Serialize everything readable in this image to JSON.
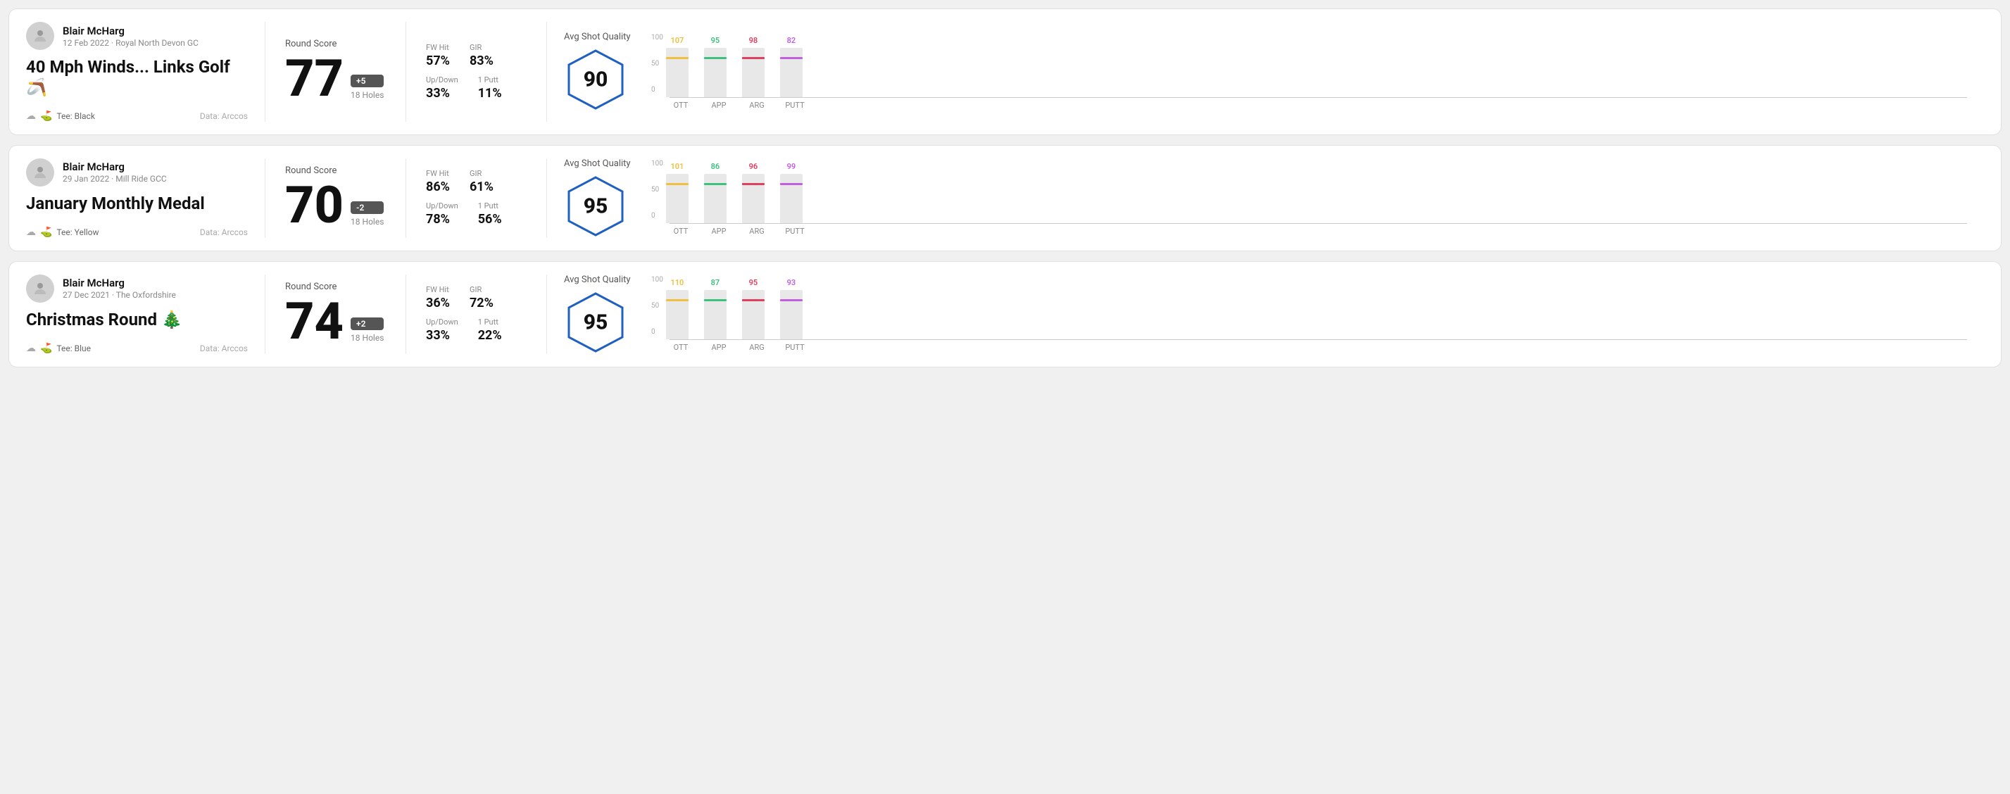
{
  "rounds": [
    {
      "id": "round-1",
      "user": {
        "name": "Blair McHarg",
        "meta": "12 Feb 2022 · Royal North Devon GC"
      },
      "title": "40 Mph Winds... Links Golf 🪃",
      "tee": "Black",
      "data_source": "Data: Arccos",
      "score": {
        "label": "Round Score",
        "number": "77",
        "modifier": "+5",
        "modifier_type": "over",
        "holes": "18 Holes"
      },
      "stats": {
        "fw_hit_label": "FW Hit",
        "fw_hit_value": "57%",
        "gir_label": "GIR",
        "gir_value": "83%",
        "updown_label": "Up/Down",
        "updown_value": "33%",
        "oneputt_label": "1 Putt",
        "oneputt_value": "11%"
      },
      "quality": {
        "label": "Avg Shot Quality",
        "score": "90"
      },
      "chart": {
        "bars": [
          {
            "label": "OTT",
            "value": 107,
            "color": "#f0c040",
            "max": 130
          },
          {
            "label": "APP",
            "value": 95,
            "color": "#40c080",
            "max": 130
          },
          {
            "label": "ARG",
            "value": 98,
            "color": "#e04060",
            "max": 130
          },
          {
            "label": "PUTT",
            "value": 82,
            "color": "#c060e0",
            "max": 130
          }
        ],
        "y_labels": [
          "100",
          "50",
          "0"
        ]
      }
    },
    {
      "id": "round-2",
      "user": {
        "name": "Blair McHarg",
        "meta": "29 Jan 2022 · Mill Ride GCC"
      },
      "title": "January Monthly Medal",
      "tee": "Yellow",
      "data_source": "Data: Arccos",
      "score": {
        "label": "Round Score",
        "number": "70",
        "modifier": "-2",
        "modifier_type": "under",
        "holes": "18 Holes"
      },
      "stats": {
        "fw_hit_label": "FW Hit",
        "fw_hit_value": "86%",
        "gir_label": "GIR",
        "gir_value": "61%",
        "updown_label": "Up/Down",
        "updown_value": "78%",
        "oneputt_label": "1 Putt",
        "oneputt_value": "56%"
      },
      "quality": {
        "label": "Avg Shot Quality",
        "score": "95"
      },
      "chart": {
        "bars": [
          {
            "label": "OTT",
            "value": 101,
            "color": "#f0c040",
            "max": 130
          },
          {
            "label": "APP",
            "value": 86,
            "color": "#40c080",
            "max": 130
          },
          {
            "label": "ARG",
            "value": 96,
            "color": "#e04060",
            "max": 130
          },
          {
            "label": "PUTT",
            "value": 99,
            "color": "#c060e0",
            "max": 130
          }
        ],
        "y_labels": [
          "100",
          "50",
          "0"
        ]
      }
    },
    {
      "id": "round-3",
      "user": {
        "name": "Blair McHarg",
        "meta": "27 Dec 2021 · The Oxfordshire"
      },
      "title": "Christmas Round 🎄",
      "tee": "Blue",
      "data_source": "Data: Arccos",
      "score": {
        "label": "Round Score",
        "number": "74",
        "modifier": "+2",
        "modifier_type": "over",
        "holes": "18 Holes"
      },
      "stats": {
        "fw_hit_label": "FW Hit",
        "fw_hit_value": "36%",
        "gir_label": "GIR",
        "gir_value": "72%",
        "updown_label": "Up/Down",
        "updown_value": "33%",
        "oneputt_label": "1 Putt",
        "oneputt_value": "22%"
      },
      "quality": {
        "label": "Avg Shot Quality",
        "score": "95"
      },
      "chart": {
        "bars": [
          {
            "label": "OTT",
            "value": 110,
            "color": "#f0c040",
            "max": 130
          },
          {
            "label": "APP",
            "value": 87,
            "color": "#40c080",
            "max": 130
          },
          {
            "label": "ARG",
            "value": 95,
            "color": "#e04060",
            "max": 130
          },
          {
            "label": "PUTT",
            "value": 93,
            "color": "#c060e0",
            "max": 130
          }
        ],
        "y_labels": [
          "100",
          "50",
          "0"
        ]
      }
    }
  ]
}
